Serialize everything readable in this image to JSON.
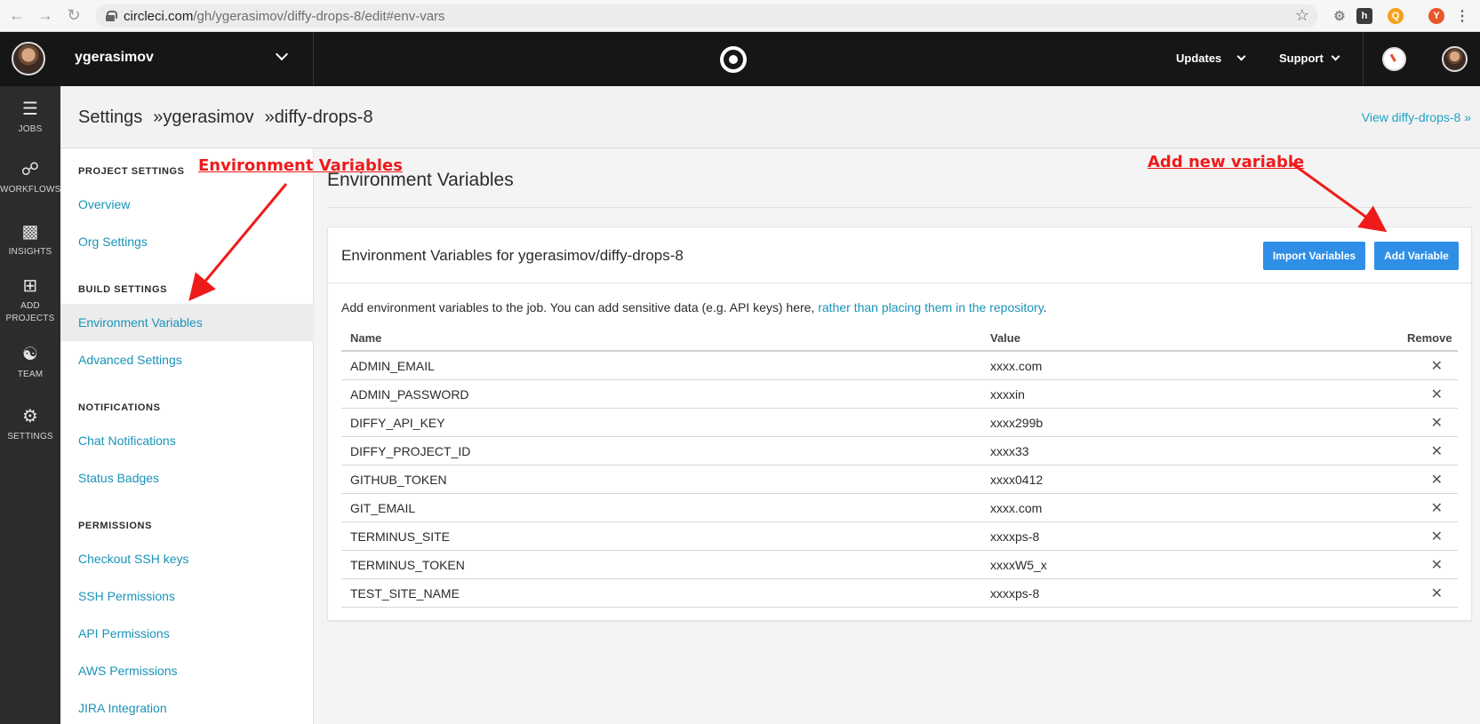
{
  "browser": {
    "url_host": "circleci.com",
    "url_path": "/gh/ygerasimov/diffy-drops-8/edit#env-vars",
    "profile_letter": "Y"
  },
  "header": {
    "org_name": "ygerasimov",
    "updates_label": "Updates",
    "support_label": "Support"
  },
  "rail": [
    {
      "label": "JOBS",
      "icon": "jobs-icon"
    },
    {
      "label": "WORKFLOWS",
      "icon": "workflows-icon"
    },
    {
      "label": "INSIGHTS",
      "icon": "insights-icon"
    },
    {
      "label_line1": "ADD",
      "label_line2": "PROJECTS",
      "icon": "add-projects-icon"
    },
    {
      "label": "TEAM",
      "icon": "team-icon"
    },
    {
      "label": "SETTINGS",
      "icon": "settings-icon"
    }
  ],
  "page": {
    "breadcrumb": [
      "Settings",
      "ygerasimov",
      "diffy-drops-8"
    ],
    "breadcrumb_sep": "»",
    "view_link": "View diffy-drops-8 »"
  },
  "sidebar": {
    "project_heading": "PROJECT SETTINGS",
    "project_items": [
      "Overview",
      "Org Settings"
    ],
    "build_heading": "BUILD SETTINGS",
    "build_items": [
      "Environment Variables",
      "Advanced Settings"
    ],
    "notifications_heading": "NOTIFICATIONS",
    "notifications_items": [
      "Chat Notifications",
      "Status Badges"
    ],
    "permissions_heading": "PERMISSIONS",
    "permissions_items": [
      "Checkout SSH keys",
      "SSH Permissions",
      "API Permissions",
      "AWS Permissions",
      "JIRA Integration"
    ]
  },
  "main": {
    "section_title": "Environment Variables",
    "card_title": "Environment Variables for ygerasimov/diffy-drops-8",
    "import_button": "Import Variables",
    "add_button": "Add Variable",
    "description": "Add environment variables to the job. You can add sensitive data (e.g. API keys) here, ",
    "description_link": "rather than placing them in the repository",
    "description_end": ".",
    "columns": {
      "name": "Name",
      "value": "Value",
      "remove": "Remove"
    },
    "rows": [
      {
        "name": "ADMIN_EMAIL",
        "value": "xxxx.com"
      },
      {
        "name": "ADMIN_PASSWORD",
        "value": "xxxxin"
      },
      {
        "name": "DIFFY_API_KEY",
        "value": "xxxx299b"
      },
      {
        "name": "DIFFY_PROJECT_ID",
        "value": "xxxx33"
      },
      {
        "name": "GITHUB_TOKEN",
        "value": "xxxx0412"
      },
      {
        "name": "GIT_EMAIL",
        "value": "xxxx.com"
      },
      {
        "name": "TERMINUS_SITE",
        "value": "xxxxps-8"
      },
      {
        "name": "TERMINUS_TOKEN",
        "value": "xxxxW5_x"
      },
      {
        "name": "TEST_SITE_NAME",
        "value": "xxxxps-8"
      }
    ],
    "remove_glyph": "✕"
  },
  "annotations": {
    "env_vars": "Environment Variables",
    "add_new": "Add new variable"
  },
  "colors": {
    "accent": "#1993b8",
    "button": "#2f8fe6",
    "annotation": "#ef1b1b"
  }
}
